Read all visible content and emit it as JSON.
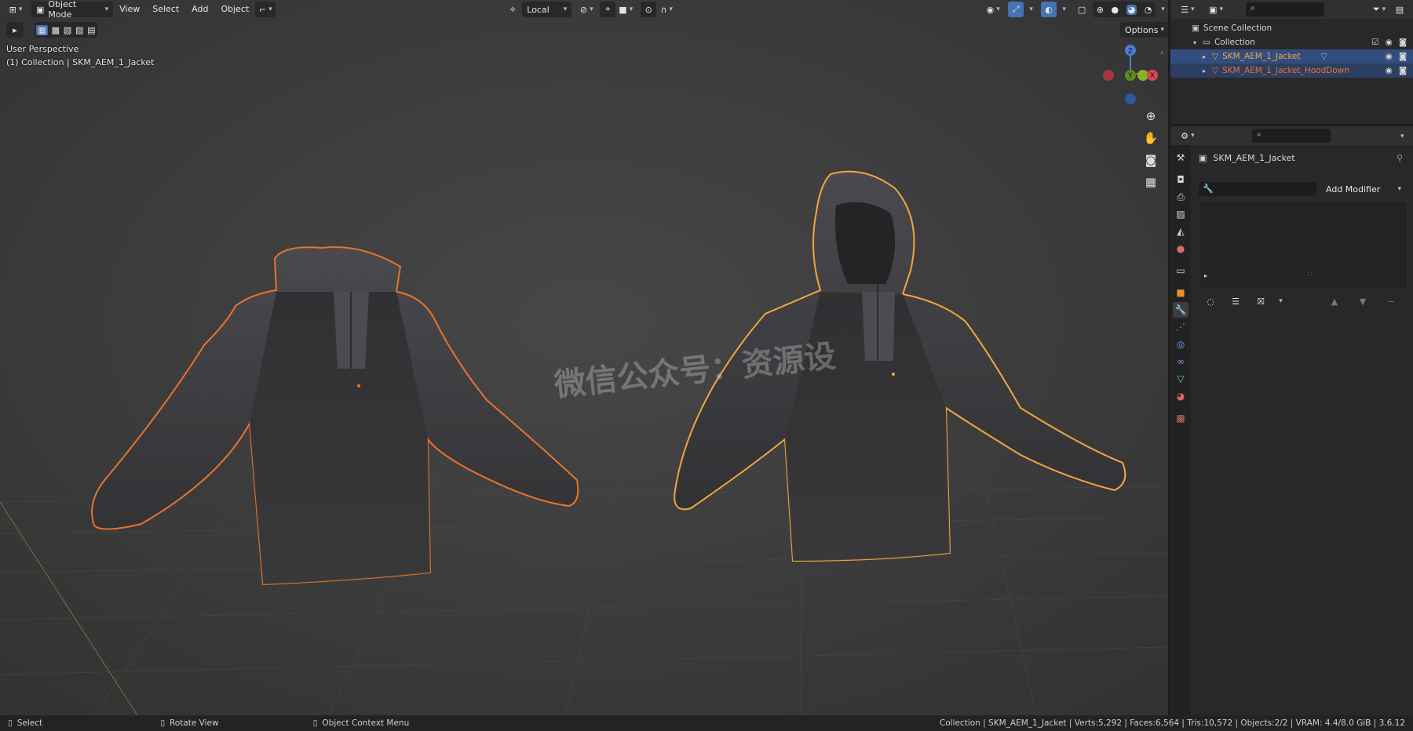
{
  "viewport_header": {
    "mode": "Object Mode",
    "menus": [
      "View",
      "Select",
      "Add",
      "Object"
    ],
    "transform_orientation": "Local",
    "options_label": "Options"
  },
  "viewport_overlay": {
    "perspective": "User Perspective",
    "collection": "(1) Collection | SKM_AEM_1_Jacket",
    "watermark": "微信公众号：资源设",
    "gizmo": {
      "z": "Z",
      "y": "Y",
      "x": "X"
    }
  },
  "outliner": {
    "search_placeholder": "",
    "scene_collection": "Scene Collection",
    "collection": "Collection",
    "items": [
      {
        "name": "SKM_AEM_1_Jacket",
        "selected": true
      },
      {
        "name": "SKM_AEM_1_Jacket_HoodDown",
        "selected": true
      }
    ]
  },
  "properties": {
    "object_name": "SKM_AEM_1_Jacket",
    "add_modifier": "Add Modifier",
    "tabs": [
      "tool-icon",
      "render-icon",
      "output-icon",
      "view-layer-icon",
      "scene-icon",
      "world-icon",
      "collection-icon",
      "object-icon",
      "modifier-icon",
      "particles-icon",
      "physics-icon",
      "constraints-icon",
      "data-icon",
      "material-icon",
      "texture-icon"
    ]
  },
  "statusbar": {
    "select": "Select",
    "rotate_view": "Rotate View",
    "context_menu": "Object Context Menu",
    "stats": "Collection | SKM_AEM_1_Jacket | Verts:5,292 | Faces:6,564 | Tris:10,572 | Objects:2/2 | VRAM: 4.4/8.0 GiB | 3.6.12"
  },
  "colors": {
    "selected_outline": "#e8732a",
    "active_outline": "#f0a640",
    "viewport_bg": "#3d3d3d",
    "selection_blue": "#4772b3"
  }
}
